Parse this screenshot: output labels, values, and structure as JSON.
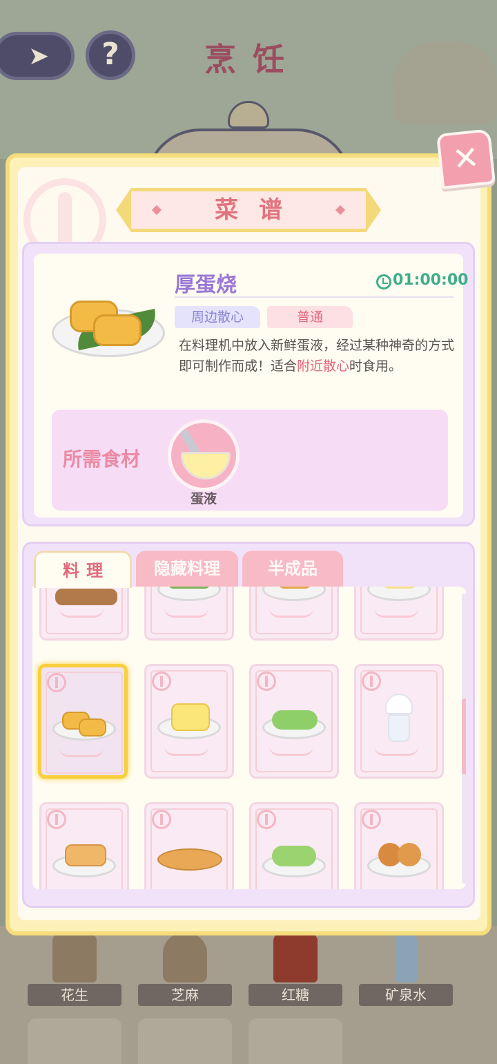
{
  "background": {
    "screen_title": "烹饪",
    "back_icon": "back-arrow-icon",
    "help_label": "?",
    "inventory": [
      {
        "label": "花生"
      },
      {
        "label": "芝麻"
      },
      {
        "label": "红糖"
      },
      {
        "label": "矿泉水"
      }
    ]
  },
  "modal": {
    "title": "菜谱",
    "close_label": "✕"
  },
  "detail": {
    "name": "厚蛋烧",
    "time": "01:00:00",
    "tag_category": "周边散心",
    "tag_grade": "普通",
    "desc_prefix": "在料理机中放入新鲜蛋液，经过某种神奇的方式即可制作而成！适合",
    "desc_highlight": "附近散心",
    "desc_suffix": "时食用。",
    "ingredients_label": "所需食材",
    "ingredients": [
      {
        "name": "蛋液"
      }
    ]
  },
  "tabs": [
    {
      "label": "料理",
      "active": true
    },
    {
      "label": "隐藏料理",
      "active": false
    },
    {
      "label": "半成品",
      "active": false
    }
  ],
  "colors": {
    "accent_pink": "#e0747e",
    "accent_purple": "#9a77d6",
    "timer_green": "#3fae8a",
    "highlight_red": "#e0657a",
    "selected_gold": "#f8d03e"
  }
}
